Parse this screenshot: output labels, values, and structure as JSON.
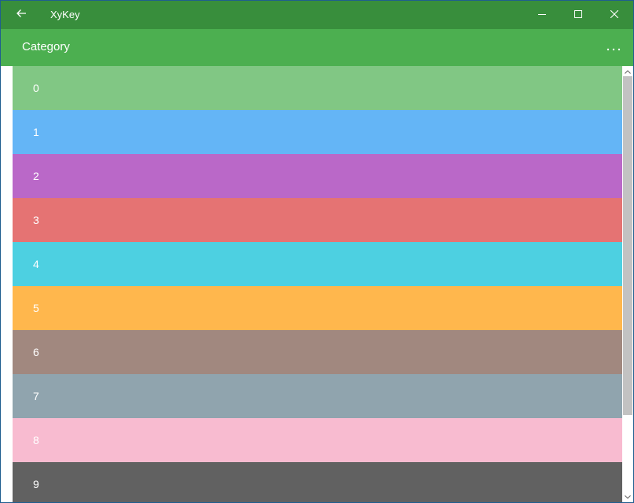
{
  "window": {
    "title": "XyKey",
    "icons": {
      "back": "back-arrow-icon",
      "minimize": "minimize-icon",
      "maximize": "maximize-icon",
      "close": "close-icon"
    },
    "colors": {
      "titlebar": "#388e3c"
    }
  },
  "appbar": {
    "title": "Category",
    "more_icon": "more-ellipsis-icon",
    "colors": {
      "background": "#4caf50"
    }
  },
  "categories": [
    {
      "label": "0",
      "color": "#81c784"
    },
    {
      "label": "1",
      "color": "#64b5f6"
    },
    {
      "label": "2",
      "color": "#ba68c8"
    },
    {
      "label": "3",
      "color": "#e57373"
    },
    {
      "label": "4",
      "color": "#4dd0e1"
    },
    {
      "label": "5",
      "color": "#ffb74d"
    },
    {
      "label": "6",
      "color": "#a1887f"
    },
    {
      "label": "7",
      "color": "#90a4ae"
    },
    {
      "label": "8",
      "color": "#f8bbd0"
    },
    {
      "label": "9",
      "color": "#616161"
    }
  ]
}
